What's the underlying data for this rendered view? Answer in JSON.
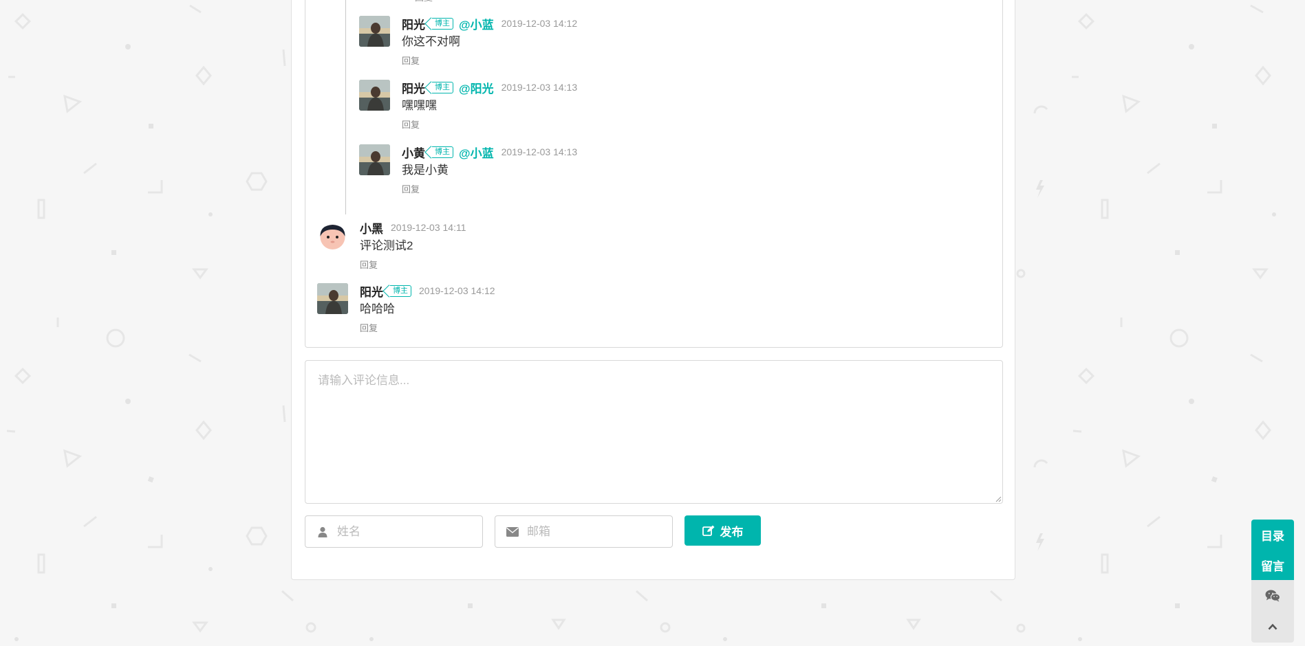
{
  "comments": {
    "cut_reply_label": "回复",
    "items": [
      {
        "name": "阳光",
        "tag": "博主",
        "at": "@小蓝",
        "time": "2019-12-03 14:12",
        "text": "你这不对啊",
        "reply": "回复",
        "avatar": "photo-avatar"
      },
      {
        "name": "阳光",
        "tag": "博主",
        "at": "@阳光",
        "time": "2019-12-03 14:13",
        "text": "嘿嘿嘿",
        "reply": "回复",
        "avatar": "photo-avatar"
      },
      {
        "name": "小黄",
        "tag": "博主",
        "at": "@小蓝",
        "time": "2019-12-03 14:13",
        "text": "我是小黄",
        "reply": "回复",
        "avatar": "photo-avatar"
      },
      {
        "name": "小黑",
        "time": "2019-12-03 14:11",
        "text": "评论测试2",
        "reply": "回复",
        "avatar": "cartoon-avatar"
      },
      {
        "name": "阳光",
        "tag": "博主",
        "time": "2019-12-03 14:12",
        "text": "哈哈哈",
        "reply": "回复",
        "avatar": "photo-avatar"
      }
    ]
  },
  "form": {
    "content_placeholder": "请输入评论信息...",
    "name_placeholder": "姓名",
    "email_placeholder": "邮箱",
    "submit_label": "发布",
    "name_icon": "user-icon",
    "email_icon": "envelope-icon",
    "submit_icon": "edit-icon"
  },
  "toolbar": {
    "toc_label": "目录",
    "message_label": "留言",
    "wechat_icon": "wechat-icon",
    "top_icon": "chevron-up-icon"
  },
  "colors": {
    "accent": "#00b5ad",
    "background": "#f6f6f6",
    "muted": "#999999"
  }
}
